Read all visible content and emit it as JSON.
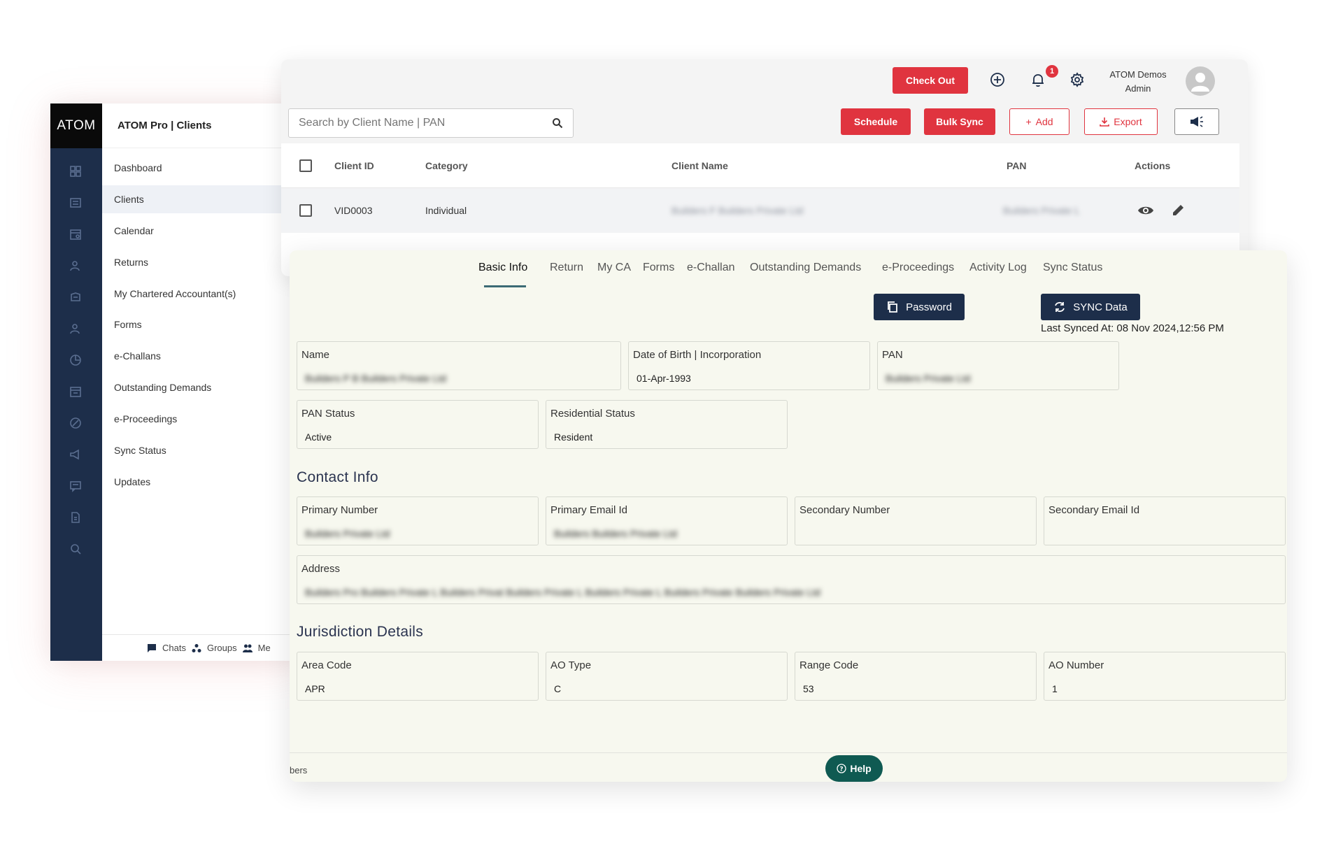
{
  "sidebar": {
    "logo": "ATOM",
    "app_title": "ATOM Pro | Clients",
    "rail_icons": [
      "dashboard-icon",
      "clients-icon",
      "calendar-icon",
      "returns-icon",
      "accountants-icon",
      "forms-icon",
      "challans-icon",
      "demands-icon",
      "proceedings-icon",
      "sync-icon",
      "updates-icon",
      "document-icon",
      "search-icon"
    ],
    "items": [
      {
        "label": "Dashboard"
      },
      {
        "label": "Clients"
      },
      {
        "label": "Calendar"
      },
      {
        "label": "Returns"
      },
      {
        "label": "My Chartered Accountant(s)"
      },
      {
        "label": "Forms"
      },
      {
        "label": "e-Challans"
      },
      {
        "label": "Outstanding Demands"
      },
      {
        "label": "e-Proceedings"
      },
      {
        "label": "Sync Status"
      },
      {
        "label": "Updates"
      }
    ],
    "bottom": {
      "chats": "Chats",
      "groups": "Groups",
      "members": "Me"
    }
  },
  "topbar": {
    "checkout_label": "Check Out",
    "notification_count": "1",
    "user_name": "ATOM Demos",
    "user_role": "Admin"
  },
  "toolbar": {
    "search_placeholder": "Search by Client Name | PAN",
    "schedule_label": "Schedule",
    "bulk_sync_label": "Bulk Sync",
    "add_label": "Add",
    "export_label": "Export"
  },
  "table": {
    "columns": [
      "Client ID",
      "Category",
      "Client Name",
      "PAN",
      "Actions"
    ],
    "rows": [
      {
        "client_id": "VID0003",
        "category": "Individual",
        "client_name": "Builders F Builders Private Ltd",
        "pan": "Builders Private L"
      }
    ]
  },
  "detail": {
    "tabs": [
      "Basic Info",
      "Return",
      "My CA",
      "Forms",
      "e-Challan",
      "Outstanding Demands",
      "e-Proceedings",
      "Activity Log",
      "Sync Status"
    ],
    "active_tab": "Basic Info",
    "password_label": "Password",
    "sync_label": "SYNC Data",
    "last_synced": "Last Synced At: 08 Nov 2024,12:56 PM",
    "basic": {
      "name_label": "Name",
      "name_value": "Builders P B Builders Private Ltd",
      "dob_label": "Date of Birth | Incorporation",
      "dob_value": "01-Apr-1993",
      "pan_label": "PAN",
      "pan_value": "Builders Private Ltd",
      "pan_status_label": "PAN Status",
      "pan_status_value": "Active",
      "residential_label": "Residential Status",
      "residential_value": "Resident"
    },
    "contact": {
      "title": "Contact Info",
      "primary_number_label": "Primary Number",
      "primary_number_value": "Builders Private Ltd",
      "primary_email_label": "Primary Email Id",
      "primary_email_value": "Builders Builders Private Ltd",
      "secondary_number_label": "Secondary Number",
      "secondary_email_label": "Secondary Email Id",
      "address_label": "Address",
      "address_value": "Builders Pro Builders Private L Builders Privat Builders Private L Builders Private L Builders Private Builders Private Ltd"
    },
    "jurisdiction": {
      "title": "Jurisdiction Details",
      "area_code_label": "Area Code",
      "area_code_value": "APR",
      "ao_type_label": "AO Type",
      "ao_type_value": "C",
      "range_code_label": "Range Code",
      "range_code_value": "53",
      "ao_number_label": "AO Number",
      "ao_number_value": "1"
    },
    "footer_text": "bers",
    "help_label": "Help"
  },
  "colors": {
    "accent_red": "#e0343f",
    "navy": "#1d2e4a",
    "help_green": "#0f5a52"
  }
}
